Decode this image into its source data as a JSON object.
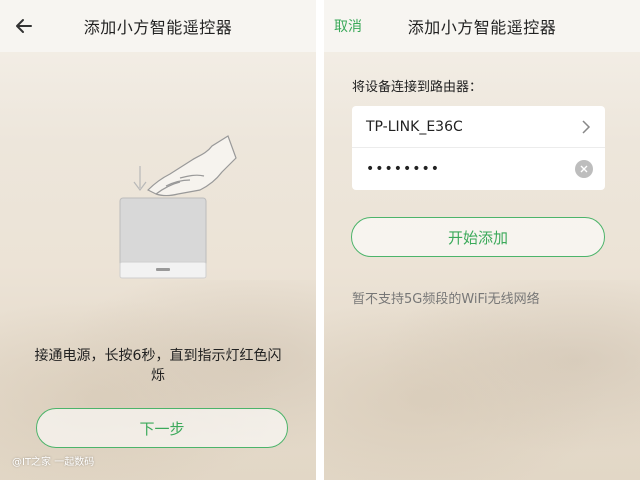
{
  "left_screen": {
    "header": {
      "title": "添加小方智能遥控器",
      "back_icon": "arrow-left-icon"
    },
    "instruction": "接通电源，长按6秒，直到指示灯红色闪烁",
    "next_button": "下一步",
    "watermark": "@IT之家 一起数码",
    "illustration": [
      "hand-press-icon",
      "down-arrow-icon",
      "device-box"
    ]
  },
  "right_screen": {
    "header": {
      "cancel_label": "取消",
      "title": "添加小方智能遥控器"
    },
    "section_label": "将设备连接到路由器：",
    "ssid_value": "TP-LINK_E36C",
    "password_value": "password",
    "start_button": "开始添加",
    "notice": "暂不支持5G频段的WiFi无线网络",
    "icons": [
      "chevron-right-icon",
      "clear-icon"
    ]
  },
  "colors": {
    "accent_green": "#3ba95a",
    "button_border": "#4cb46a",
    "header_bg": "#f7f5f1",
    "background_warm": "#ece3d6"
  }
}
